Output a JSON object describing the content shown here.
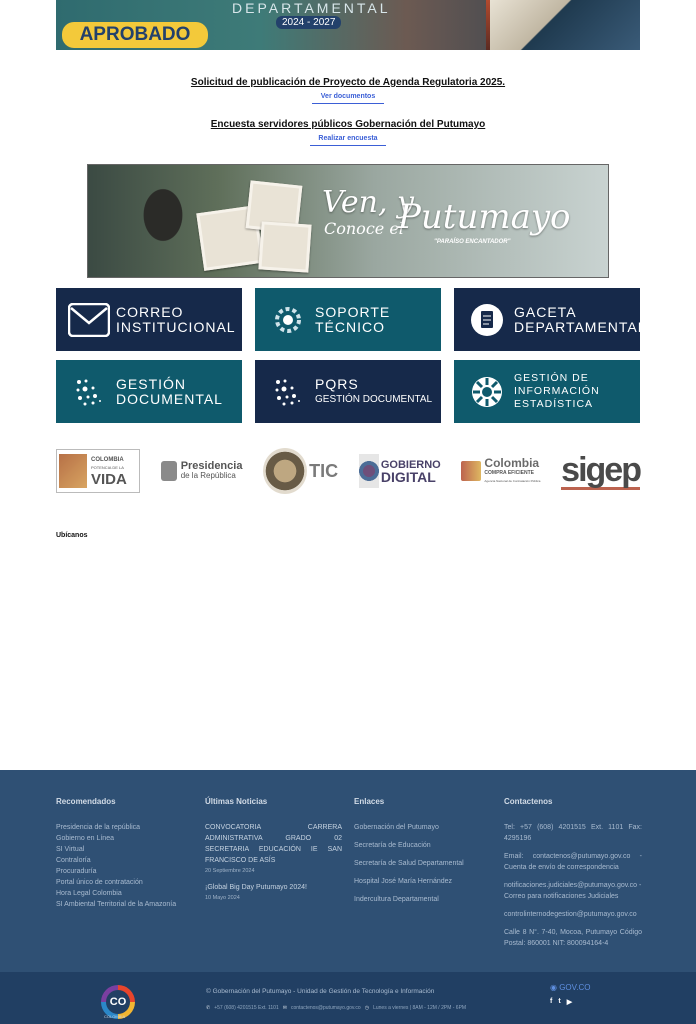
{
  "top_banner": {
    "badge": "APROBADO",
    "department": "DEPARTAMENTAL",
    "years": "2024 - 2027"
  },
  "links": [
    {
      "title": "Solicitud de publicación de Proyecto de Agenda Regulatoria 2025.",
      "button": "Ver documentos"
    },
    {
      "title": "Encuesta servidores públicos Gobernación del Putumayo",
      "button": "Realizar encuesta"
    }
  ],
  "putumayo_banner": {
    "ven": "Ven, y",
    "conoce": "Conoce el",
    "name": "Putumayo",
    "tagline": "\"PARAÍSO ENCANTADOR\""
  },
  "tiles": [
    {
      "line1": "CORREO",
      "line2": "INSTITUCIONAL",
      "icon": "mail-icon",
      "color": "navy"
    },
    {
      "line1": "SOPORTE",
      "line2": "TÉCNICO",
      "icon": "gear-icon",
      "color": "teal"
    },
    {
      "line1": "GACETA",
      "line2": "DEPARTAMENTAL",
      "icon": "document-icon",
      "color": "navy"
    },
    {
      "line1": "GESTIÓN",
      "line2": "DOCUMENTAL",
      "icon": "dots-icon",
      "color": "teal"
    },
    {
      "line1": "PQRS",
      "line2": "GESTIÓN DOCUMENTAL",
      "icon": "dots-icon",
      "color": "navy"
    },
    {
      "line1": "GESTIÓN DE",
      "line2": "INFORMACIÓN",
      "line3": "ESTADÍSTICA",
      "icon": "sun-icon",
      "color": "teal"
    }
  ],
  "logos": [
    {
      "text_top": "COLOMBIA",
      "text_mid": "POTENCIA DE LA",
      "text_bottom": "VIDA"
    },
    {
      "text_top": "Presidencia",
      "text_bottom": "de la República"
    },
    {
      "text": "TIC"
    },
    {
      "text_top": "GOBIERNO",
      "text_bottom": "DIGITAL"
    },
    {
      "text_top": "Colombia",
      "text_mid": "COMPRA EFICIENTE",
      "text_bottom": "Agencia Nacional de Contratación Pública"
    },
    {
      "text": "sigep"
    }
  ],
  "ubicanos": "Ubícanos",
  "footer": {
    "recomendados": {
      "title": "Recomendados",
      "items": [
        "Presidencia de la república",
        "Gobierno en Línea",
        "SI Virtual",
        "Contraloría",
        "Procuraduría",
        "Portal único de contratación",
        "Hora Legal Colombia",
        "SI Ambiental Territorial de la Amazonía"
      ]
    },
    "noticias": {
      "title": "Últimas Noticias",
      "items": [
        {
          "text": "CONVOCATORIA CARRERA ADMINISTRATIVA GRADO 02 SECRETARIA EDUCACIÓN IE SAN FRANCISCO DE ASÍS",
          "date": "20 Septiembre 2024"
        },
        {
          "text": "¡Global Big Day Putumayo 2024!",
          "date": "10 Mayo 2024"
        }
      ]
    },
    "enlaces": {
      "title": "Enlaces",
      "items": [
        "Gobernación del Putumayo",
        "Secretaría de Educación",
        "Secretaría de Salud Departamental",
        "Hospital José María Hernández",
        "Indercultura Departamental"
      ]
    },
    "contactenos": {
      "title": "Contactenos",
      "items": [
        "Tel: +57 (608) 4201515 Ext. 1101 Fax: 4295196",
        "Email: contactenos@putumayo.gov.co - Cuenta de envío de correspondencia",
        "notificaciones.judiciales@putumayo.gov.co - Correo para notificaciones Judiciales",
        "controlinternodegestion@putumayo.gov.co",
        "Calle 8 N°. 7-40, Mocoa, Putumayo Código Postal: 860001 NIT: 800094164-4"
      ]
    }
  },
  "bottom": {
    "co_logo": "CO",
    "co_sub": "COLOMBIA",
    "copyright": "© Gobernación del Putumayo - Unidad de Gestión de Tecnología e Información",
    "phone": "+57 (608) 4201515 Ext. 1101",
    "email": "contactenos@putumayo.gov.co",
    "hours": "Lunes a viernes | 8AM - 12M / 2PM - 6PM",
    "govco": "GOV.CO",
    "social": [
      "f",
      "t",
      "▶"
    ]
  }
}
